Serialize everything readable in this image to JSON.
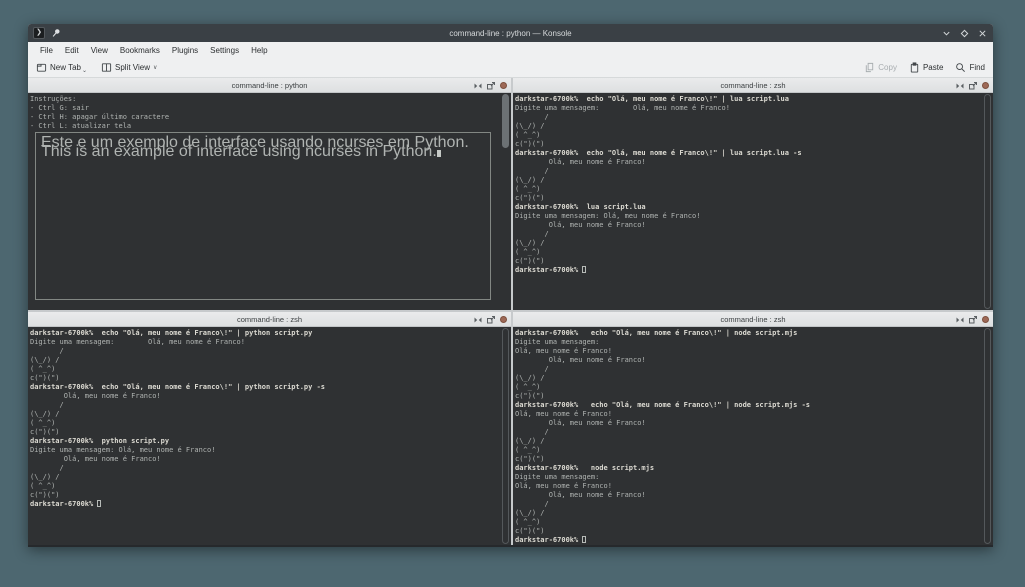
{
  "window": {
    "title": "command-line : python — Konsole"
  },
  "icons": {
    "app": "konsole-terminal-icon",
    "pin": "pin-icon",
    "minimize": "chevron-down",
    "maximize": "diamond",
    "close": "x-cross",
    "new_tab": "tab-plus",
    "split_view": "split-columns",
    "copy": "pages",
    "paste": "clipboard",
    "find": "magnifier",
    "pane_maximize": "bowtie-arrows",
    "pane_detach": "window-arrow-out",
    "pane_close": "brown-circle"
  },
  "menu": {
    "items": [
      "File",
      "Edit",
      "View",
      "Bookmarks",
      "Plugins",
      "Settings",
      "Help"
    ]
  },
  "toolbar": {
    "new_tab_label": "New Tab",
    "split_view_label": "Split View",
    "copy_label": "Copy",
    "paste_label": "Paste",
    "find_label": "Find",
    "copy_enabled": false
  },
  "colors": {
    "desktop_bg": "#4d6770",
    "titlebar_bg": "#3a4045",
    "chrome_bg": "#eff0f1",
    "terminal_bg": "#2f3133",
    "terminal_fg": "#b0b4b2",
    "command_fg": "#dcdad2",
    "pane_close_dot": "#9e6957",
    "splitter": "#c7cacc"
  },
  "panes": [
    {
      "title": "command-line : python",
      "focused": true,
      "instructions": [
        {
          "c": 0,
          "s": "Instruções:"
        },
        {
          "c": 0,
          "s": "- Ctrl G: sair"
        },
        {
          "c": 0,
          "s": "- Ctrl H: apagar último caractere"
        },
        {
          "c": 0,
          "s": "- Ctrl L: atualizar tela"
        }
      ],
      "box_lines": [
        {
          "c": 0,
          "s": "Este e um exemplo de interface usando ncurses em Python."
        },
        {
          "c": 0,
          "s": "This is an example of interface using ncurses in Python.",
          "cursor": "solid"
        }
      ]
    },
    {
      "title": "command-line : zsh",
      "focused": false,
      "lines": [
        {
          "c": 1,
          "s": "darkstar-6700k%  echo \"Olá, meu nome é Franco\\!\" | lua script.lua"
        },
        {
          "c": 0,
          "s": "Digite uma mensagem:        Olá, meu nome é Franco!"
        },
        {
          "c": 0,
          "s": "       /"
        },
        {
          "c": 0,
          "s": "(\\_/) /"
        },
        {
          "c": 0,
          "s": "( ^_^)"
        },
        {
          "c": 0,
          "s": "c(\")(\")"
        },
        {
          "c": 1,
          "s": "darkstar-6700k%  echo \"Olá, meu nome é Franco\\!\" | lua script.lua -s"
        },
        {
          "c": 0,
          "s": "        Olá, meu nome é Franco!"
        },
        {
          "c": 0,
          "s": "       /"
        },
        {
          "c": 0,
          "s": "(\\_/) /"
        },
        {
          "c": 0,
          "s": "( ^_^)"
        },
        {
          "c": 0,
          "s": "c(\")(\")"
        },
        {
          "c": 1,
          "s": "darkstar-6700k%  lua script.lua"
        },
        {
          "c": 0,
          "s": "Digite uma mensagem: Olá, meu nome é Franco!"
        },
        {
          "c": 0,
          "s": "        Olá, meu nome é Franco!"
        },
        {
          "c": 0,
          "s": "       /"
        },
        {
          "c": 0,
          "s": "(\\_/) /"
        },
        {
          "c": 0,
          "s": "( ^_^)"
        },
        {
          "c": 0,
          "s": "c(\")(\")"
        },
        {
          "c": 1,
          "s": "darkstar-6700k% ",
          "cursor": "hollow"
        }
      ]
    },
    {
      "title": "command-line : zsh",
      "focused": false,
      "lines": [
        {
          "c": 1,
          "s": "darkstar-6700k%  echo \"Olá, meu nome é Franco\\!\" | python script.py"
        },
        {
          "c": 0,
          "s": "Digite uma mensagem:        Olá, meu nome é Franco!"
        },
        {
          "c": 0,
          "s": "       /"
        },
        {
          "c": 0,
          "s": "(\\_/) /"
        },
        {
          "c": 0,
          "s": "( ^_^)"
        },
        {
          "c": 0,
          "s": "c(\")(\")"
        },
        {
          "c": 1,
          "s": "darkstar-6700k%  echo \"Olá, meu nome é Franco\\!\" | python script.py -s"
        },
        {
          "c": 0,
          "s": "        Olá, meu nome é Franco!"
        },
        {
          "c": 0,
          "s": "       /"
        },
        {
          "c": 0,
          "s": "(\\_/) /"
        },
        {
          "c": 0,
          "s": "( ^_^)"
        },
        {
          "c": 0,
          "s": "c(\")(\")"
        },
        {
          "c": 1,
          "s": "darkstar-6700k%  python script.py"
        },
        {
          "c": 0,
          "s": "Digite uma mensagem: Olá, meu nome é Franco!"
        },
        {
          "c": 0,
          "s": "        Olá, meu nome é Franco!"
        },
        {
          "c": 0,
          "s": "       /"
        },
        {
          "c": 0,
          "s": "(\\_/) /"
        },
        {
          "c": 0,
          "s": "( ^_^)"
        },
        {
          "c": 0,
          "s": "c(\")(\")"
        },
        {
          "c": 1,
          "s": "darkstar-6700k% ",
          "cursor": "hollow"
        }
      ]
    },
    {
      "title": "command-line : zsh",
      "focused": false,
      "lines": [
        {
          "c": 1,
          "s": "darkstar-6700k%   echo \"Olá, meu nome é Franco\\!\" | node script.mjs"
        },
        {
          "c": 0,
          "s": "Digite uma mensagem:"
        },
        {
          "c": 0,
          "s": "Olá, meu nome é Franco!"
        },
        {
          "c": 0,
          "s": "        Olá, meu nome é Franco!"
        },
        {
          "c": 0,
          "s": "       /"
        },
        {
          "c": 0,
          "s": "(\\_/) /"
        },
        {
          "c": 0,
          "s": "( ^_^)"
        },
        {
          "c": 0,
          "s": "c(\")(\")"
        },
        {
          "c": 1,
          "s": "darkstar-6700k%   echo \"Olá, meu nome é Franco\\!\" | node script.mjs -s"
        },
        {
          "c": 0,
          "s": "Olá, meu nome é Franco!"
        },
        {
          "c": 0,
          "s": "        Olá, meu nome é Franco!"
        },
        {
          "c": 0,
          "s": "       /"
        },
        {
          "c": 0,
          "s": "(\\_/) /"
        },
        {
          "c": 0,
          "s": "( ^_^)"
        },
        {
          "c": 0,
          "s": "c(\")(\")"
        },
        {
          "c": 1,
          "s": "darkstar-6700k%   node script.mjs"
        },
        {
          "c": 0,
          "s": "Digite uma mensagem:"
        },
        {
          "c": 0,
          "s": "Olá, meu nome é Franco!"
        },
        {
          "c": 0,
          "s": "        Olá, meu nome é Franco!"
        },
        {
          "c": 0,
          "s": "       /"
        },
        {
          "c": 0,
          "s": "(\\_/) /"
        },
        {
          "c": 0,
          "s": "( ^_^)"
        },
        {
          "c": 0,
          "s": "c(\")(\")"
        },
        {
          "c": 1,
          "s": "darkstar-6700k% ",
          "cursor": "hollow"
        }
      ]
    }
  ]
}
